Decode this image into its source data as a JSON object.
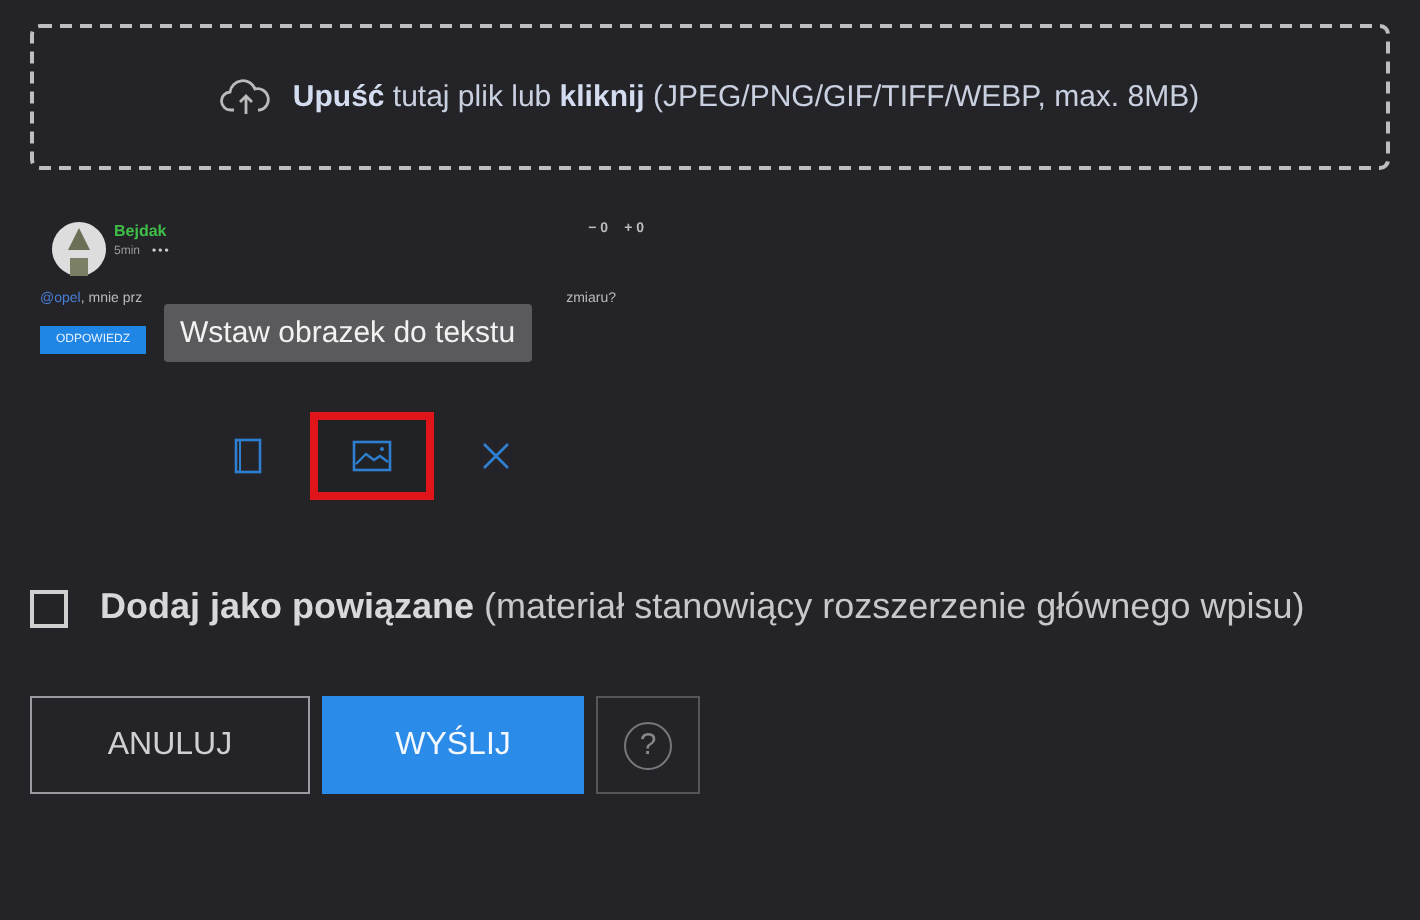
{
  "dropzone": {
    "text": "**Upuść** tutaj plik lub **kliknij** (JPEG/PNG/GIF/TIFF/WEBP, max. 8MB)"
  },
  "preview": {
    "author": "Bejdak",
    "time": "5min",
    "menu": "•••",
    "votes": [
      {
        "sign": "−",
        "count": "0"
      },
      {
        "sign": "+",
        "count": "0"
      }
    ],
    "mention": "@opel",
    "text_start": ", mnie prz",
    "text_end": "zmiaru?",
    "reply_button": "ODPOWIEDZ"
  },
  "tooltip": "Wstaw obrazek do tekstu",
  "tools": [
    {
      "kind": "document",
      "highlighted": false
    },
    {
      "kind": "image",
      "highlighted": true
    },
    {
      "kind": "close",
      "highlighted": false
    }
  ],
  "related": {
    "checked": false,
    "label": "Dodaj jako powiązane",
    "note": "(materiał stanowiący rozszerzenie głównego wpisu)"
  },
  "buttons": [
    {
      "kind": "cancel",
      "label": "ANULUJ"
    },
    {
      "kind": "submit",
      "label": "WYŚLIJ"
    },
    {
      "kind": "help",
      "label": "?"
    }
  ]
}
